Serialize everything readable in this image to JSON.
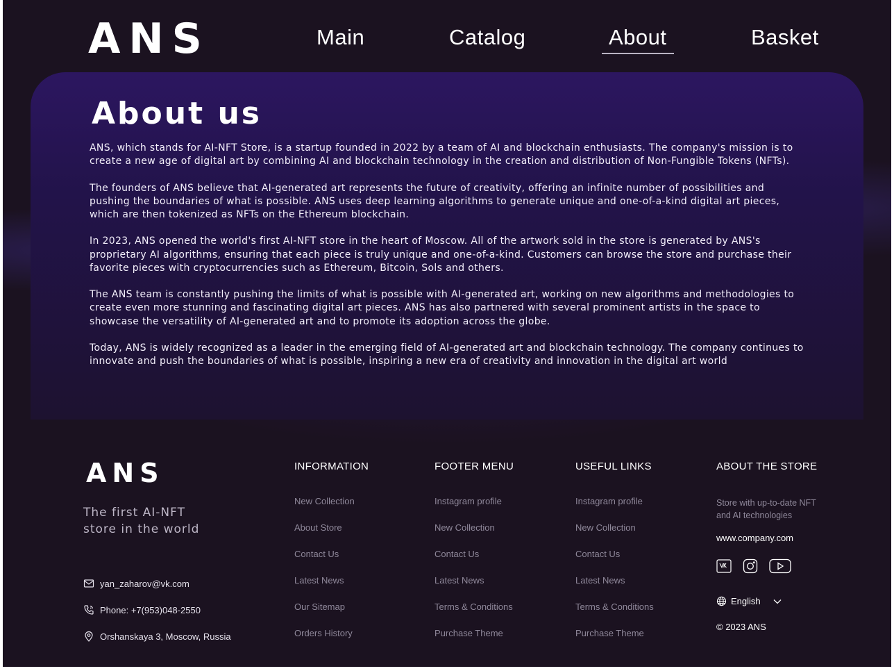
{
  "header": {
    "logo": "ANS",
    "nav": [
      {
        "label": "Main"
      },
      {
        "label": "Catalog"
      },
      {
        "label": "About"
      },
      {
        "label": "Basket"
      }
    ],
    "active_nav": "About"
  },
  "about": {
    "title": "About us",
    "paragraphs": [
      "ANS, which stands for AI-NFT Store, is a startup founded in 2022 by a team of AI and blockchain enthusiasts. The company's mission is to create a new age of digital art by combining AI and blockchain technology in the creation and distribution of Non-Fungible Tokens (NFTs).",
      "The founders of ANS believe that AI-generated art represents the future of creativity, offering an infinite number of possibilities and pushing the boundaries of what is possible. ANS uses deep learning algorithms to generate unique and one-of-a-kind digital art pieces, which are then tokenized as NFTs on the Ethereum blockchain.",
      "In 2023, ANS opened the world's first AI-NFT store in the heart of Moscow. All of the artwork sold in the store is generated by ANS's proprietary AI algorithms, ensuring that each piece is truly unique and one-of-a-kind. Customers can browse the store and purchase their favorite pieces with cryptocurrencies such as Ethereum, Bitcoin, Sols and others.",
      "The ANS team is constantly pushing the limits of what is possible with AI-generated art, working on new algorithms and methodologies to create even more stunning and fascinating digital art pieces. ANS has also partnered with several prominent artists in the space to showcase the versatility of AI-generated art and to promote its adoption across the globe.",
      "Today, ANS is widely recognized as a leader in the emerging field of AI-generated art and blockchain technology. The company continues to innovate and push the boundaries of what is possible, inspiring a new era of creativity and innovation in the digital art world"
    ]
  },
  "footer": {
    "logo": "ANS",
    "tagline": "The first AI-NFT store in the world",
    "contacts": {
      "email": "yan_zaharov@vk.com",
      "phone": "Phone: +7(953)048-2550",
      "address": "Orshanskaya 3, Moscow, Russia"
    },
    "columns": [
      {
        "title": "INFORMATION",
        "links": [
          "New Collection",
          "About Store",
          "Contact Us",
          "Latest News",
          "Our Sitemap",
          "Orders History"
        ]
      },
      {
        "title": "FOOTER MENU",
        "links": [
          "Instagram profile",
          "New Collection",
          "Contact Us",
          "Latest News",
          "Terms & Conditions",
          "Purchase Theme"
        ]
      },
      {
        "title": "USEFUL LINKS",
        "links": [
          "Instagram profile",
          "New Collection",
          "Contact Us",
          "Latest News",
          "Terms & Conditions",
          "Purchase Theme"
        ]
      }
    ],
    "about_store": {
      "title": "ABOUT THE STORE",
      "description": "Store with up-to-date NFT and AI technologies",
      "website": "www.company.com",
      "socials": [
        "vk-icon",
        "instagram-icon",
        "youtube-icon"
      ],
      "language": "English",
      "copyright": "© 2023 ANS"
    }
  },
  "colors": {
    "background": "#1b1220",
    "panel_top": "#2c1660",
    "muted_text": "#8f889a",
    "nav_underline": "#b9b3c3"
  }
}
